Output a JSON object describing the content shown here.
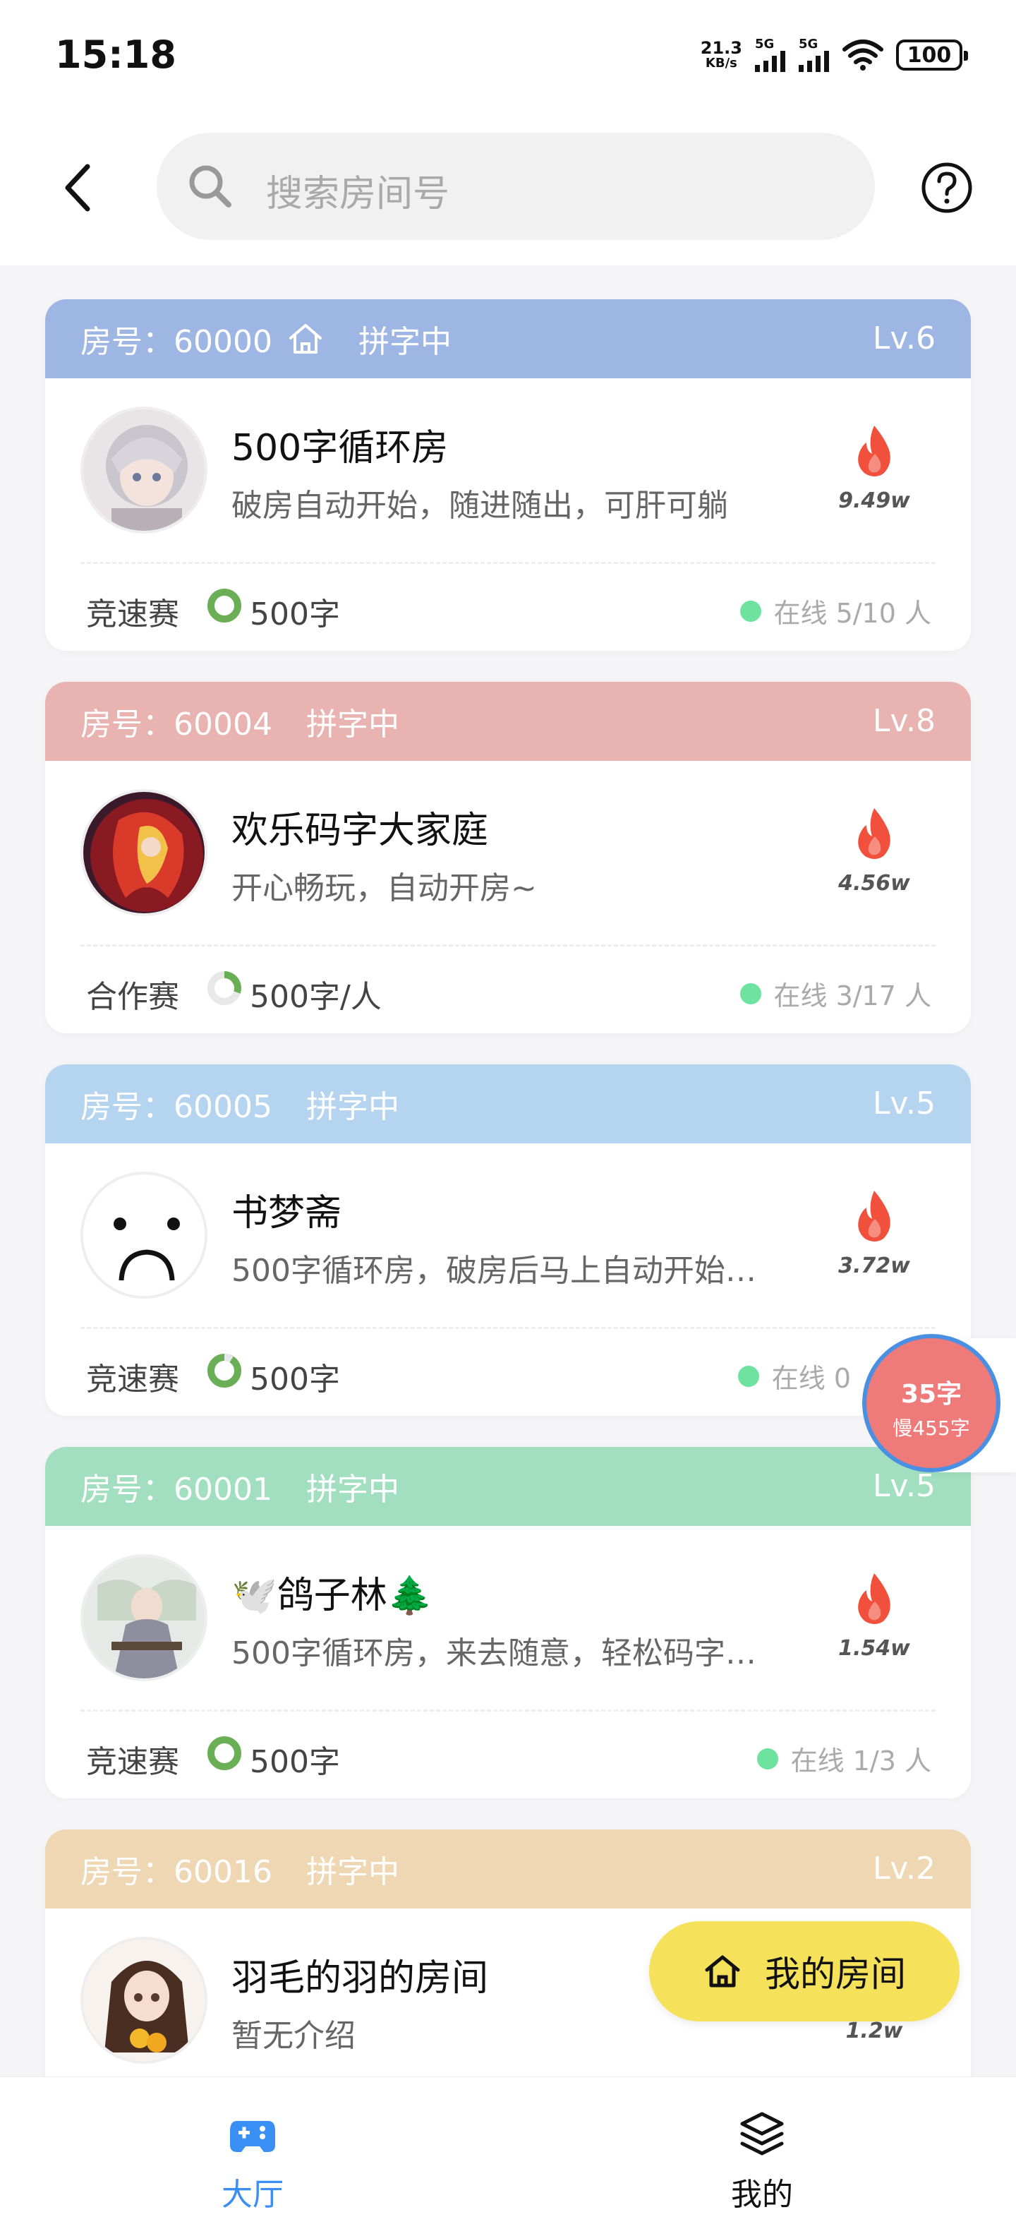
{
  "status_bar": {
    "time": "15:18",
    "net_speed_value": "21.3",
    "net_speed_unit": "KB/s",
    "signal1_label": "5G",
    "signal2_label": "5G",
    "battery": "100"
  },
  "header": {
    "search_placeholder": "搜索房间号",
    "icons": [
      "back-arrow-icon",
      "search-icon",
      "help-icon"
    ]
  },
  "rooms": [
    {
      "room_no": "房号：60000",
      "has_home_icon": true,
      "state": "拼字中",
      "level": "Lv.6",
      "header_color": "#9db6e3",
      "name": "500字循环房",
      "desc": "破房自动开始，随进随出，可肝可躺",
      "heat": "9.49w",
      "mode": "竞速赛",
      "goal": "500字",
      "progress": 0.0,
      "online": "在线 5/10 人"
    },
    {
      "room_no": "房号：60004",
      "has_home_icon": false,
      "state": "拼字中",
      "level": "Lv.8",
      "header_color": "#e8b3b1",
      "name": "欢乐码字大家庭",
      "desc": "开心畅玩，自动开房~",
      "heat": "4.56w",
      "mode": "合作赛",
      "goal": "500字/人",
      "progress": 0.3,
      "online": "在线 3/17 人"
    },
    {
      "room_no": "房号：60005",
      "has_home_icon": false,
      "state": "拼字中",
      "level": "Lv.5",
      "header_color": "#b5d4ef",
      "name": "书梦斋",
      "desc": "500字循环房，破房后马上自动开始…",
      "heat": "3.72w",
      "mode": "竞速赛",
      "goal": "500字",
      "progress": 0.1,
      "online": "在线 0"
    },
    {
      "room_no": "房号：60001",
      "has_home_icon": false,
      "state": "拼字中",
      "level": "Lv.5",
      "header_color": "#a1dfc0",
      "name": "🕊️鸽子林🌲",
      "desc": "500字循环房，来去随意，轻松码字…",
      "heat": "1.54w",
      "mode": "竞速赛",
      "goal": "500字",
      "progress": 0.0,
      "online": "在线 1/3 人"
    },
    {
      "room_no": "房号：60016",
      "has_home_icon": false,
      "state": "拼字中",
      "level": "Lv.2",
      "header_color": "#eed7b2",
      "name": "羽毛的羽的房间",
      "desc": "暂无介绍",
      "heat": "1.2w",
      "mode": "",
      "goal": "",
      "progress": 0.0,
      "online": ""
    }
  ],
  "float_badge": {
    "count": "35字",
    "sub": "慢455字"
  },
  "my_room_button": {
    "label": "我的房间"
  },
  "bottom_nav": {
    "lobby_label": "大厅",
    "mine_label": "我的",
    "active": "lobby"
  },
  "colors": {
    "accent_blue": "#3a8ff5",
    "flame": "#f0503c",
    "online_dot": "#6ee3a0",
    "ring_green": "#6aae56",
    "my_room_bg": "#f6e15a",
    "badge_bg": "#ee7a7a"
  }
}
